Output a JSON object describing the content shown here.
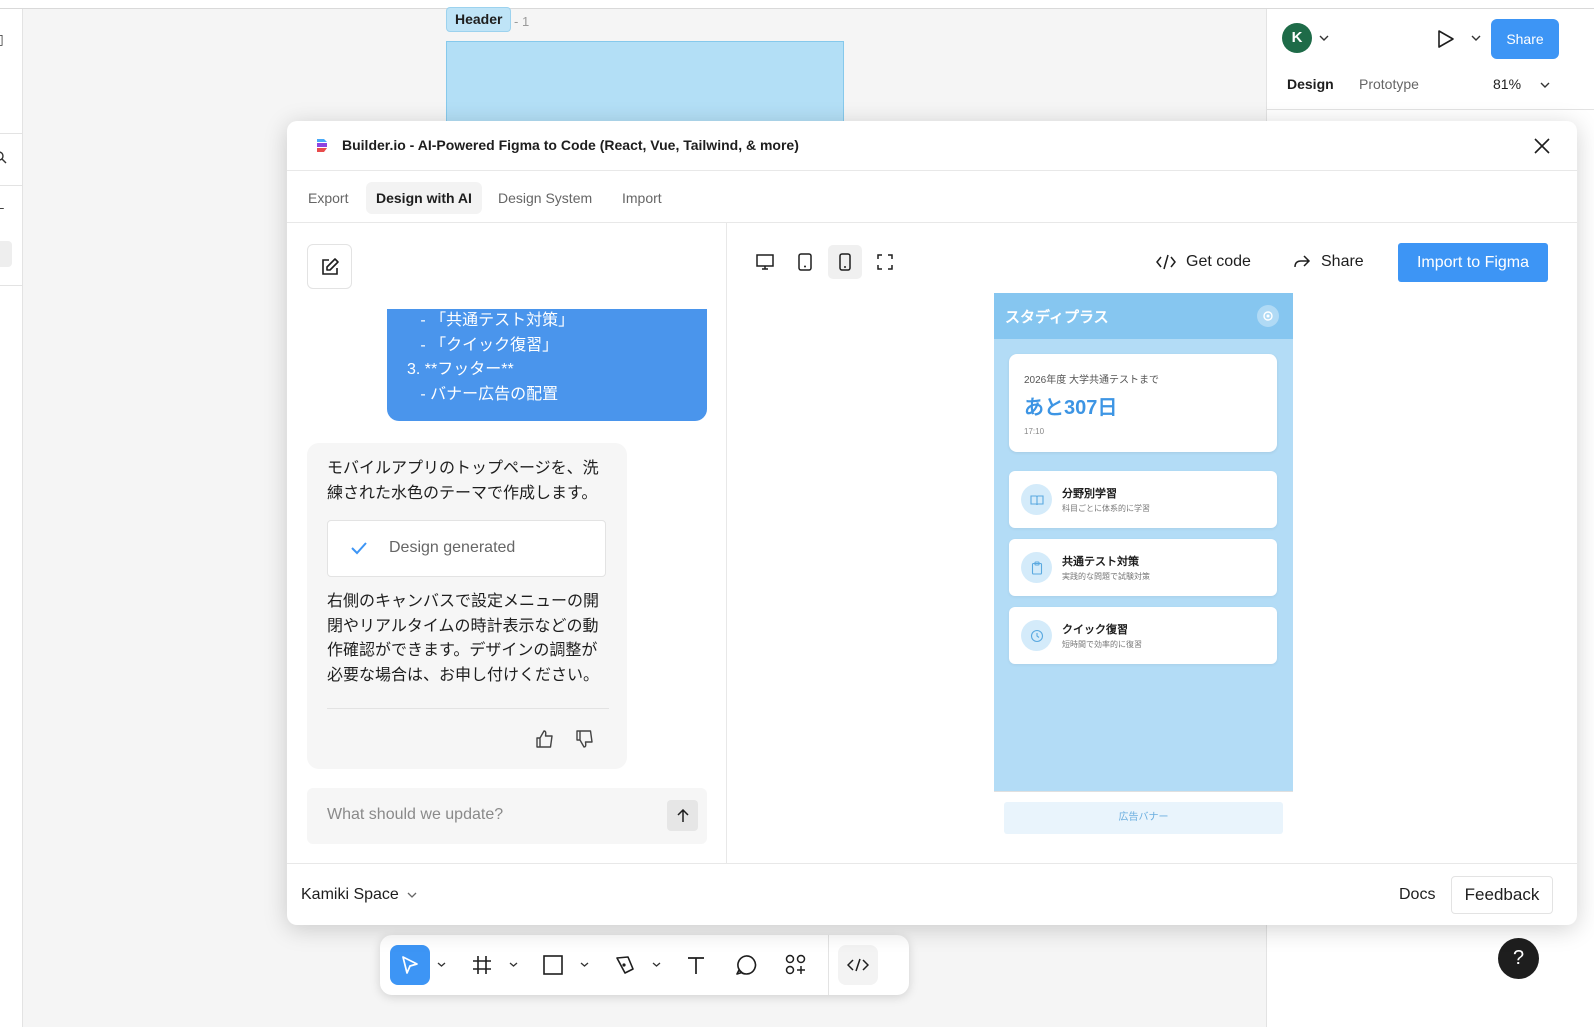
{
  "canvas": {
    "frame_label": "Header",
    "frame_count": "- 1"
  },
  "right_panel": {
    "avatar_initial": "K",
    "share_label": "Share",
    "tab_design": "Design",
    "tab_prototype": "Prototype",
    "zoom": "81%",
    "help": "?"
  },
  "plugin": {
    "title": "Builder.io - AI-Powered Figma to Code (React, Vue, Tailwind, & more)",
    "tabs": [
      {
        "label": "Export"
      },
      {
        "label": "Design with AI"
      },
      {
        "label": "Design System"
      },
      {
        "label": "Import"
      }
    ],
    "chat": {
      "user_message_lines": [
        "   - 「共通テスト対策」",
        "   - 「クイック復習」",
        "3. **フッター**",
        "   - バナー広告の配置"
      ],
      "ai_intro": "モバイルアプリのトップページを、洗練された水色のテーマで作成します。",
      "status": "Design generated",
      "ai_followup": "右側のキャンバスで設定メニューの開閉やリアルタイムの時計表示などの動作確認ができます。デザインの調整が必要な場合は、お申し付けください。",
      "prompt_placeholder": "What should we update?"
    },
    "preview": {
      "get_code": "Get code",
      "share": "Share",
      "import_button": "Import to Figma",
      "app": {
        "title": "スタディプラス",
        "countdown_label": "2026年度 大学共通テストまで",
        "countdown_days": "あと307日",
        "time": "17:10",
        "menu": [
          {
            "title": "分野別学習",
            "subtitle": "科目ごとに体系的に学習",
            "icon": "book-icon"
          },
          {
            "title": "共通テスト対策",
            "subtitle": "実践的な問題で試験対策",
            "icon": "clipboard-icon"
          },
          {
            "title": "クイック復習",
            "subtitle": "短時間で効率的に復習",
            "icon": "clock-icon"
          }
        ],
        "ad_banner": "広告バナー"
      }
    },
    "footer": {
      "workspace": "Kamiki Space",
      "docs": "Docs",
      "feedback": "Feedback"
    }
  },
  "colors": {
    "accent": "#3d95f5",
    "bubble": "#4a95ec",
    "app_header": "#86c6f0",
    "app_bg": "#b3dcf6",
    "countdown_text": "#3d95e4"
  }
}
